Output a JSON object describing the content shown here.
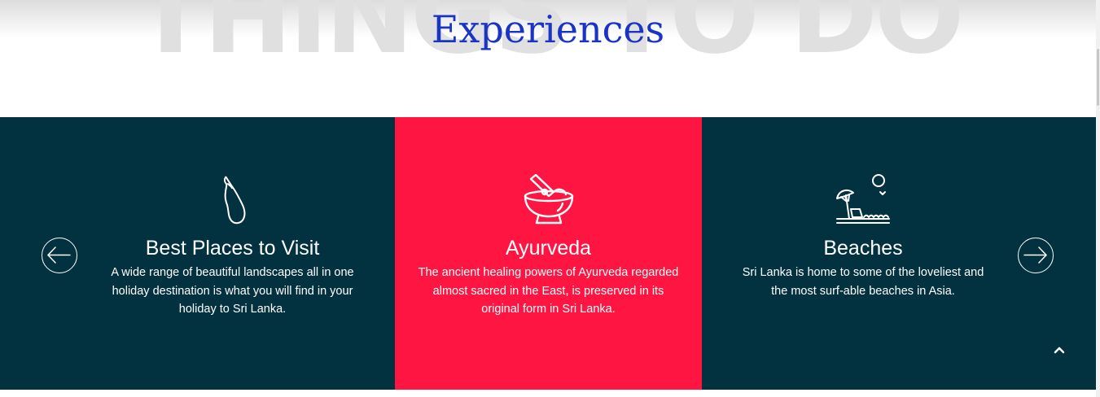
{
  "section": {
    "background_word": "THINGS TO DO",
    "heading": "Experiences"
  },
  "cards": [
    {
      "icon": "sri-lanka-map-icon",
      "title": "Best Places to Visit",
      "text": "A wide range of beautiful landscapes all in one holiday destination is what you will find in your holiday to Sri Lanka."
    },
    {
      "icon": "mortar-pestle-icon",
      "title": "Ayurveda",
      "text": "The ancient healing powers of Ayurveda regarded almost sacred in the East, is preserved in its original form in Sri Lanka."
    },
    {
      "icon": "beach-umbrella-icon",
      "title": "Beaches",
      "text": "Sri Lanka is home to some of the loveliest and the most surf-able beaches in Asia."
    }
  ],
  "controls": {
    "prev_icon": "arrow-left-circle-icon",
    "next_icon": "arrow-right-circle-icon",
    "scroll_top_icon": "chevron-up-icon"
  },
  "colors": {
    "heading": "#1a35c6",
    "dark_bg": "#02313f",
    "accent": "#fe1542",
    "background_word": "#e0e0e0"
  }
}
